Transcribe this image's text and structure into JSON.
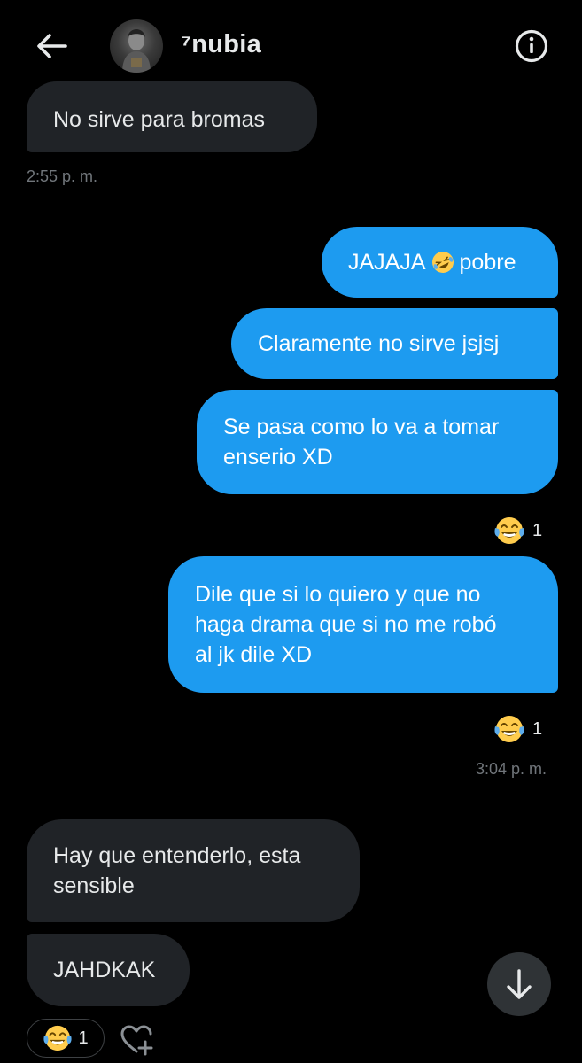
{
  "header": {
    "display_name": "⁷nubia",
    "back_icon": "arrow-left-icon",
    "info_icon": "info-circle-icon"
  },
  "messages": [
    {
      "direction": "in",
      "text": "No sirve para bromas"
    },
    {
      "direction": "in",
      "timestamp": "2:55 p. m."
    },
    {
      "direction": "out",
      "text_before": "JAJAJA",
      "emoji": "rolling-on-floor-laughing-emoji",
      "text_after": "pobre"
    },
    {
      "direction": "out",
      "text": "Claramente no sirve jsjsj"
    },
    {
      "direction": "out",
      "lines": [
        "Se pasa como lo va a tomar",
        "enserio XD"
      ],
      "reaction": {
        "emoji": "tears-of-joy-emoji",
        "count": "1"
      }
    },
    {
      "direction": "out",
      "lines": [
        "Dile que si lo quiero y que no",
        "haga drama que si no me robó",
        "al jk dile XD"
      ],
      "reaction": {
        "emoji": "tears-of-joy-emoji",
        "count": "1"
      },
      "timestamp": "3:04 p. m."
    },
    {
      "direction": "in",
      "lines": [
        "Hay que entenderlo, esta",
        "sensible"
      ]
    },
    {
      "direction": "in",
      "text": "JAHDKAK",
      "reaction": {
        "emoji": "tears-of-joy-emoji",
        "count": "1"
      }
    }
  ],
  "controls": {
    "scroll_down_icon": "arrow-down-icon",
    "add_reaction_icon": "heart-plus-icon"
  },
  "colors": {
    "background": "#000000",
    "incoming_bubble": "#202327",
    "outgoing_bubble": "#1d9bf0",
    "text_primary": "#e7e9ea",
    "text_secondary": "#71767b"
  }
}
